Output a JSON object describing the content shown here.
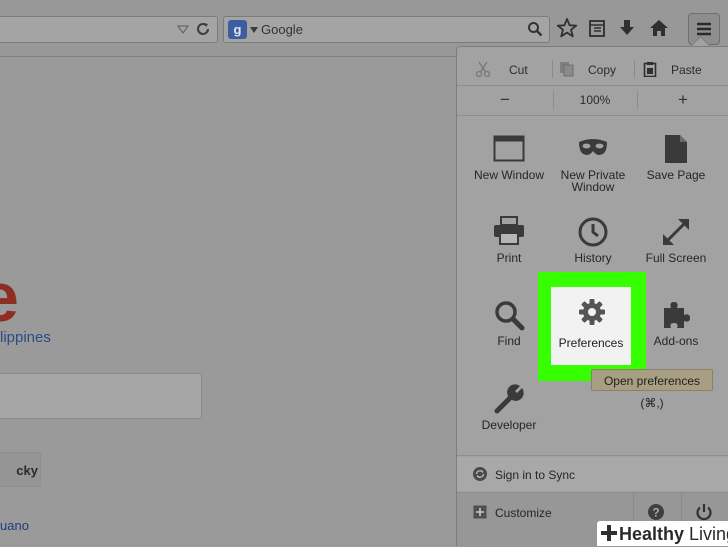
{
  "browser": {
    "search": {
      "engine": "Google"
    }
  },
  "page": {
    "logo_letter": "e",
    "region": "lippines",
    "lucky": "cky",
    "language_link": "uano"
  },
  "menu": {
    "edit": {
      "cut": "Cut",
      "copy": "Copy",
      "paste": "Paste"
    },
    "zoom": {
      "minus": "−",
      "value": "100%",
      "plus": "+"
    },
    "items": [
      {
        "label": "New Window",
        "icon": "window-icon"
      },
      {
        "label": "New Private\nWindow",
        "icon": "private-mask-icon"
      },
      {
        "label": "Save Page",
        "icon": "page-icon"
      },
      {
        "label": "Print",
        "icon": "printer-icon"
      },
      {
        "label": "History",
        "icon": "clock-icon"
      },
      {
        "label": "Full Screen",
        "icon": "fullscreen-arrows-icon"
      },
      {
        "label": "Find",
        "icon": "magnifier-icon"
      },
      {
        "label": "Preferences",
        "icon": "gear-icon"
      },
      {
        "label": "Add-ons",
        "icon": "puzzle-icon"
      },
      {
        "label": "Developer",
        "icon": "wrench-icon"
      }
    ],
    "tooltip": "Open preferences (⌘,)",
    "sync": "Sign in to Sync",
    "customize": "Customize"
  },
  "watermark": {
    "bold": "Healthy",
    "rest": " Living"
  },
  "colors": {
    "highlight": "#36ff00",
    "toolbar_bg": "#989898",
    "panel_bg": "#a2a2a2"
  }
}
